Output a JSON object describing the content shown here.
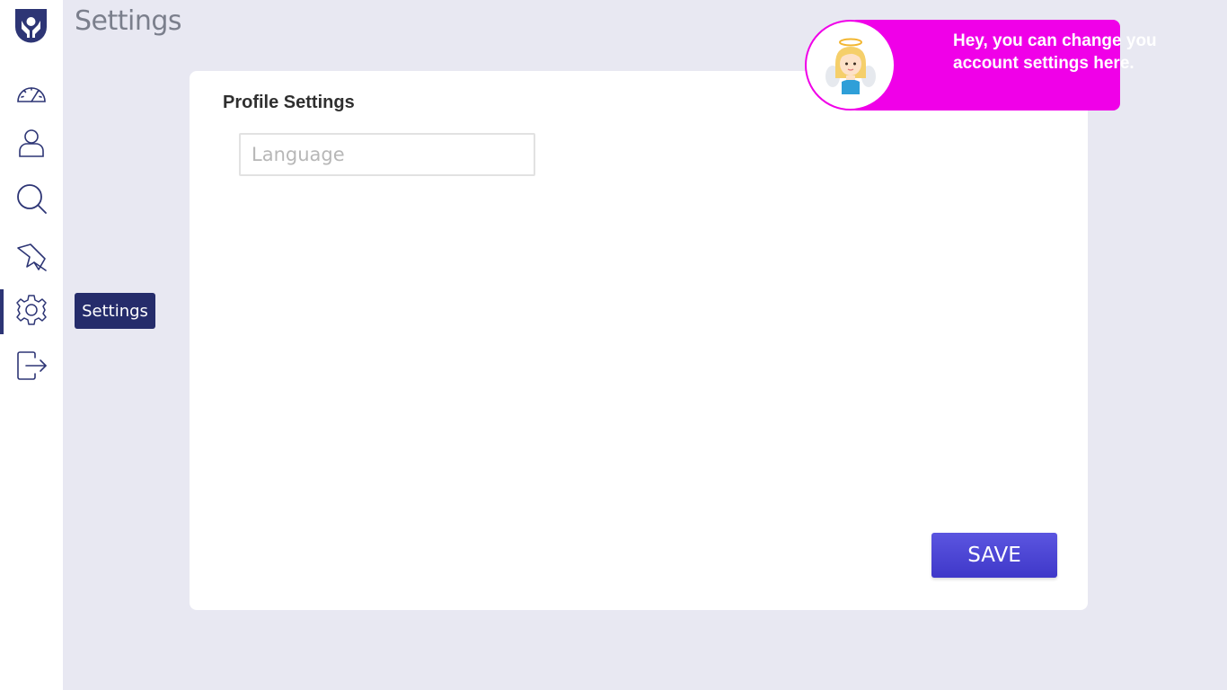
{
  "colors": {
    "brand": "#2d3575",
    "accent": "#4a44d6",
    "assistant_pink": "#f000e8",
    "background": "#e8e8f2"
  },
  "sidebar": {
    "logo_icon": "heart-hands-logo",
    "items": [
      {
        "icon": "dashboard-gauge-icon",
        "active": false
      },
      {
        "icon": "user-icon",
        "active": false
      },
      {
        "icon": "search-icon",
        "active": false
      },
      {
        "icon": "pin-icon",
        "active": false
      },
      {
        "icon": "gear-icon",
        "active": true
      },
      {
        "icon": "logout-icon",
        "active": false
      }
    ],
    "tooltip": "Settings"
  },
  "page": {
    "title": "Settings"
  },
  "profile": {
    "title": "Profile Settings",
    "language_placeholder": "Language",
    "language_value": "",
    "save_label": "SAVE"
  },
  "assistant": {
    "avatar_icon": "angel-avatar",
    "message": "Hey, you can change you account settings here."
  }
}
